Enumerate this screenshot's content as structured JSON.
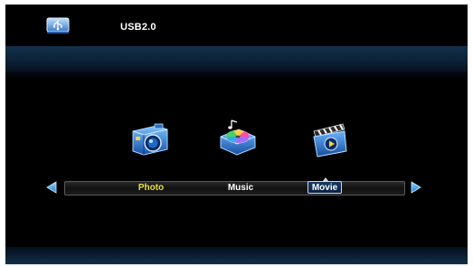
{
  "header": {
    "source_label": "USB2.0",
    "source_icon": "usb-drive-icon"
  },
  "menu": {
    "items": [
      {
        "label": "Photo",
        "icon": "camera-icon",
        "color": "#e8e23c"
      },
      {
        "label": "Music",
        "icon": "music-player-icon",
        "color": "#ffffff"
      },
      {
        "label": "Movie",
        "icon": "clapperboard-icon",
        "color": "#ffffff",
        "selected": true
      }
    ],
    "left_arrow_icon": "arrow-left-icon",
    "right_arrow_icon": "arrow-right-icon"
  },
  "colors": {
    "background": "#000000",
    "band": "#0c2237",
    "accent_blue": "#3aa7e8",
    "highlight_yellow": "#e8e23c"
  }
}
